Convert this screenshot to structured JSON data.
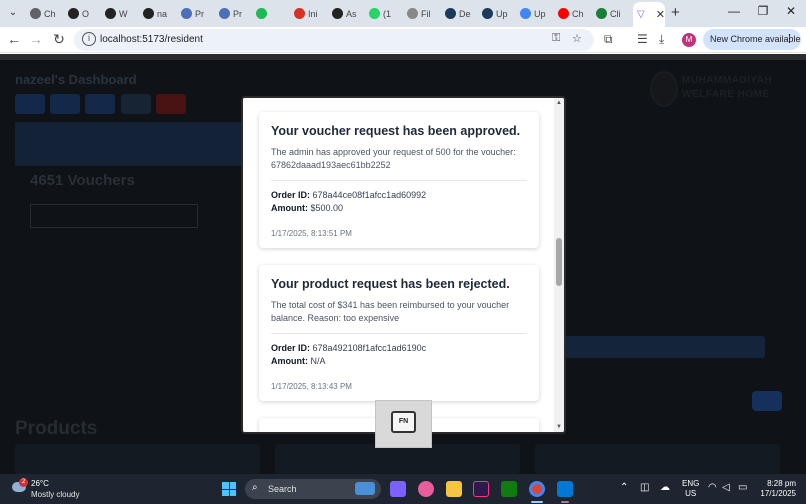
{
  "browser": {
    "tabs": [
      {
        "label": "Ch",
        "color": "#5f6368"
      },
      {
        "label": "O",
        "color": "#222222"
      },
      {
        "label": "W",
        "color": "#222222"
      },
      {
        "label": "na",
        "color": "#222222"
      },
      {
        "label": "Pr",
        "color": "#4e6fb8"
      },
      {
        "label": "Pr",
        "color": "#4e6fb8"
      },
      {
        "label": "",
        "color": "#1db954"
      },
      {
        "label": "Ini",
        "color": "#d93025"
      },
      {
        "label": "As",
        "color": "#222222"
      },
      {
        "label": "(1",
        "color": "#25d366"
      },
      {
        "label": "Fil",
        "color": "#888888"
      },
      {
        "label": "De",
        "color": "#1b3a5c"
      },
      {
        "label": "Up",
        "color": "#1b3a5c"
      },
      {
        "label": "Up",
        "color": "#4285f4"
      },
      {
        "label": "Ch",
        "color": "#ff0000"
      },
      {
        "label": "Cli",
        "color": "#1a7f37"
      }
    ],
    "active_tab_icon": "vite-icon",
    "url": "localhost:5173/resident",
    "new_chrome_label": "New Chrome available",
    "avatar_letter": "M"
  },
  "page": {
    "dashboard_title": "nazeel's Dashboard",
    "panel_text": "",
    "vouchers_text": "4651 Vouchers",
    "outline_text": "",
    "logo_lines": [
      "MUHAMMADIYAH",
      "WELFARE HOME"
    ],
    "right_note": "",
    "products_heading": "Products"
  },
  "notifications": [
    {
      "title": "Your voucher request has been approved.",
      "message": "The admin has approved your request of 500 for the voucher: 67862daaad193aec61bb2252",
      "order_label": "Order ID:",
      "order_id": "678a44ce08f1afcc1ad60992",
      "amount_label": "Amount:",
      "amount": "$500.00",
      "timestamp": "1/17/2025, 8:13:51 PM"
    },
    {
      "title": "Your product request has been rejected.",
      "message": "The total cost of $341 has been reimbursed to your voucher balance. Reason: too expensive",
      "order_label": "Order ID:",
      "order_id": "678a492108f1afcc1ad6190c",
      "amount_label": "Amount:",
      "amount": "N/A",
      "timestamp": "1/17/2025, 8:13:43 PM"
    }
  ],
  "fn_overlay": {
    "key_label": "FN"
  },
  "taskbar": {
    "weather_badge": "2",
    "temperature": "26°C",
    "weather": "Mostly cloudy",
    "search_placeholder": "Search",
    "lang_top": "ENG",
    "lang_bottom": "US",
    "time": "8:28 pm",
    "date": "17/1/2025"
  }
}
